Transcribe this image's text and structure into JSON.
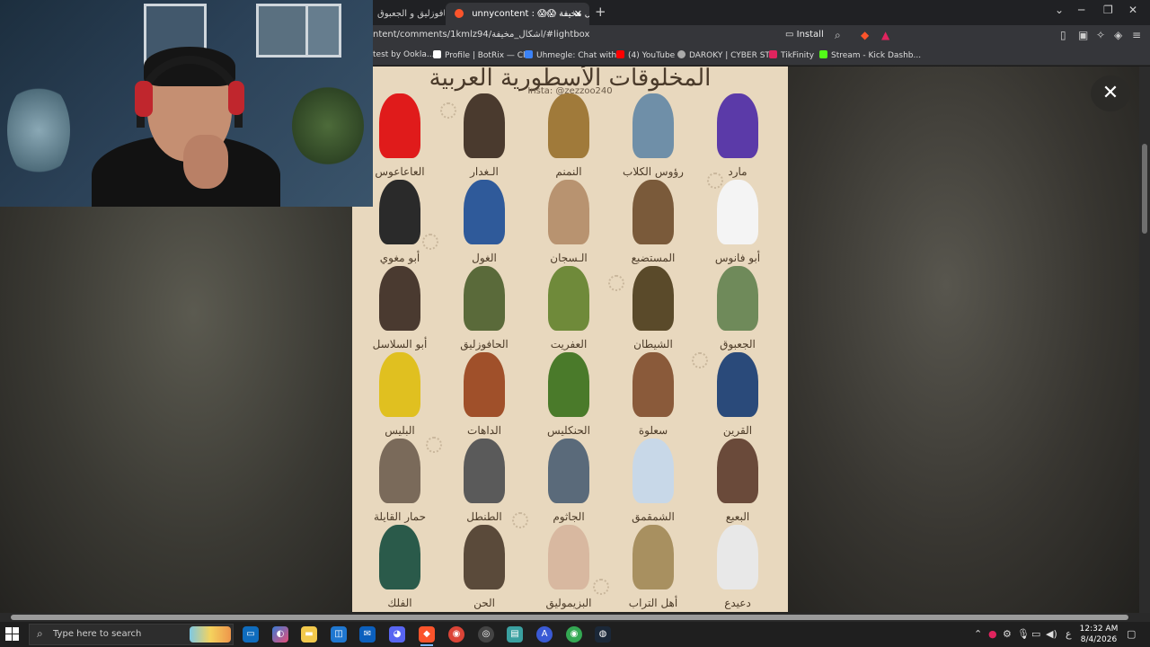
{
  "browser": {
    "tabs": [
      {
        "label": "الحافوزليق و الجعبوق"
      },
      {
        "label": "unnycontent : 😱😱 اشكال مخيفة"
      }
    ],
    "url": "ntent/comments/1kmlz94/اشكال_مخيفة/#lightbox",
    "install_label": "Install",
    "bookmarks": [
      {
        "label": "test by Ookla..."
      },
      {
        "label": "Profile | BotRix — Cl..."
      },
      {
        "label": "Uhmegle: Chat with..."
      },
      {
        "label": "(4) YouTube"
      },
      {
        "label": "DAROKY | CYBER ST..."
      },
      {
        "label": "TikFinity"
      },
      {
        "label": "Stream - Kick Dashb..."
      }
    ]
  },
  "poster": {
    "title": "المخلوقات الأسطورية العربية",
    "insta": "Insta: @zezzoo240",
    "creatures": [
      {
        "name": "مارد",
        "color": "#5b3aa8"
      },
      {
        "name": "رؤوس الكلاب",
        "color": "#6f8fa8"
      },
      {
        "name": "النمنم",
        "color": "#a07a3a"
      },
      {
        "name": "الـغدار",
        "color": "#4a3a2e"
      },
      {
        "name": "العاعاعوس",
        "color": "#e01b1b"
      },
      {
        "name": "أبو فانوس",
        "color": "#f4f4f4"
      },
      {
        "name": "المستضبع",
        "color": "#7a5a3a"
      },
      {
        "name": "الـسجان",
        "color": "#b89370"
      },
      {
        "name": "الغول",
        "color": "#2f5a9a"
      },
      {
        "name": "أبو مغوي",
        "color": "#2a2a2a"
      },
      {
        "name": "الجعبوق",
        "color": "#6f8a5a"
      },
      {
        "name": "الشيطان",
        "color": "#5a4a2a"
      },
      {
        "name": "العفريت",
        "color": "#6f8a3a"
      },
      {
        "name": "الحافوزليق",
        "color": "#5a6a3a"
      },
      {
        "name": "أبو السلاسل",
        "color": "#4a3a30"
      },
      {
        "name": "القرين",
        "color": "#2a4a7a"
      },
      {
        "name": "سعلوة",
        "color": "#8a5a3a"
      },
      {
        "name": "الحنكليس",
        "color": "#4a7a2a"
      },
      {
        "name": "الداهات",
        "color": "#a0502a"
      },
      {
        "name": "البليس",
        "color": "#e0c020"
      },
      {
        "name": "البعبع",
        "color": "#6a4a3a"
      },
      {
        "name": "الشمقمق",
        "color": "#c8d8e8"
      },
      {
        "name": "الجاثوم",
        "color": "#5a6a7a"
      },
      {
        "name": "الطنطل",
        "color": "#5a5a5a"
      },
      {
        "name": "حمار القايلة",
        "color": "#7a6a5a"
      },
      {
        "name": "دعيدع",
        "color": "#e8e8e8"
      },
      {
        "name": "أهل التراب",
        "color": "#a89060"
      },
      {
        "name": "البزيموليق",
        "color": "#d8b8a0"
      },
      {
        "name": "الحن",
        "color": "#5a4a3a"
      },
      {
        "name": "الفلك",
        "color": "#2a5a4a"
      }
    ]
  },
  "taskbar": {
    "search_placeholder": "Type here to search",
    "time": "12:32 AM",
    "date": "8/4/2026",
    "lang": "ع"
  },
  "colors": {
    "brave_accent": "#fb542b",
    "poster_bg": "#e8d8be"
  }
}
